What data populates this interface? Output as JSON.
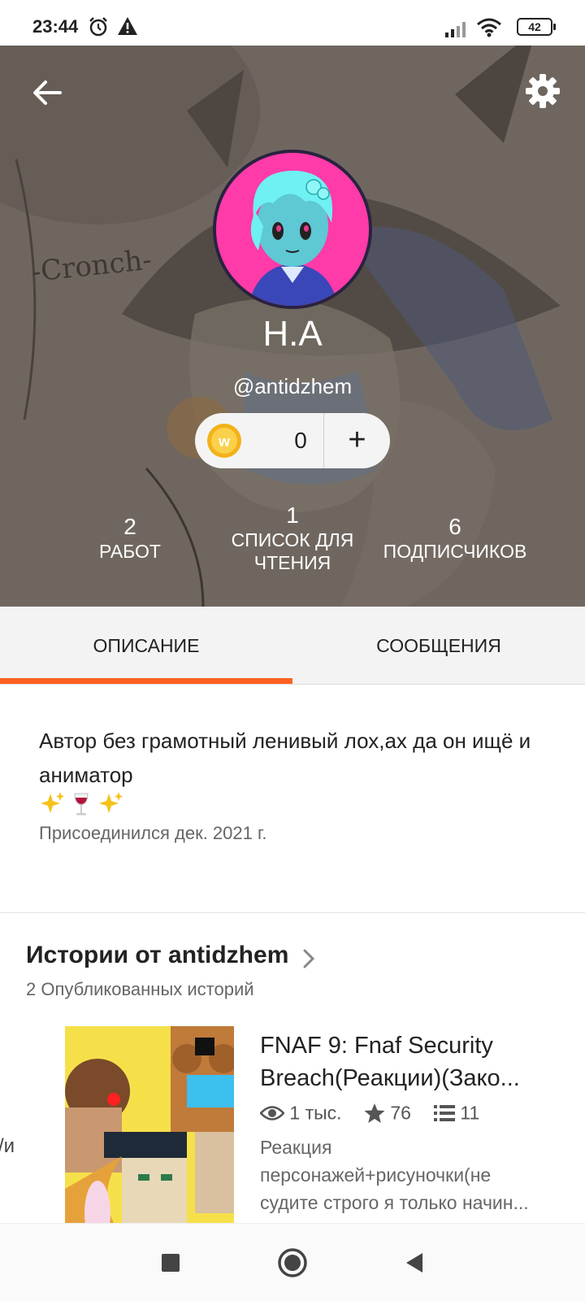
{
  "status_bar": {
    "time": "23:44",
    "battery": "42",
    "icons": [
      "alarm-icon",
      "warning-icon",
      "signal-icon",
      "wifi-icon",
      "battery-icon"
    ]
  },
  "header": {
    "art_text": "-Cronch-",
    "name": "Н.А",
    "username": "@antidzhem",
    "coins": "0",
    "add_label": "+",
    "stats": [
      {
        "value": "2",
        "label": "РАБОТ"
      },
      {
        "value": "1",
        "label_line1": "СПИСОК ДЛЯ",
        "label_line2": "ЧТЕНИЯ"
      },
      {
        "value": "6",
        "label": "ПОДПИСЧИКОВ"
      }
    ]
  },
  "tabs": [
    {
      "label": "ОПИСАНИЕ",
      "active": true
    },
    {
      "label": "СООБЩЕНИЯ",
      "active": false
    }
  ],
  "about": {
    "description": "Автор без грамотный ленивый лох,ах да он ищё и аниматор",
    "emojis": "✨🍷 ✨",
    "joined": "Присоединился дек. 2021 г."
  },
  "stories": {
    "title": "Истории от antidzhem",
    "count_label": "2 Опубликованных историй",
    "cut_off_text": "/и",
    "items": [
      {
        "title_line1": "FNAF 9: Fnaf Security",
        "title_line2": "Breach(Реакции)(Зако...",
        "reads": "1 тыс.",
        "votes": "76",
        "parts": "11",
        "description_line1": "Реакция",
        "description_line2": "персонажей+рисуночки(не",
        "description_line3": "судите строго я только начин..."
      }
    ]
  },
  "colors": {
    "accent": "#ff6122",
    "header_overlay": "#6e665e",
    "tab_bg": "#f4f3f4",
    "avatar_bg": "#ff3aa9"
  }
}
